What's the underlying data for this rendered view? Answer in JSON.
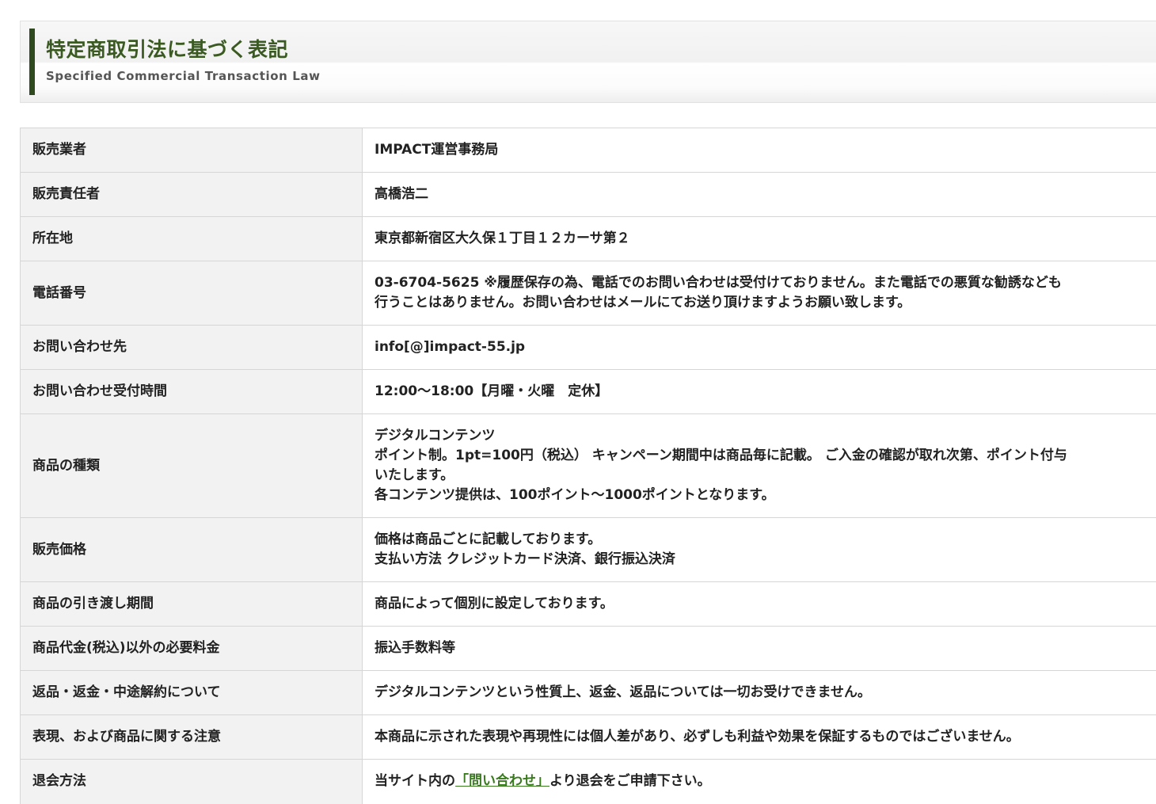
{
  "header": {
    "title": "特定商取引法に基づく表記",
    "subtitle": "Specified Commercial Transaction Law"
  },
  "rows": [
    {
      "label": "販売業者",
      "value": [
        "IMPACT運営事務局"
      ]
    },
    {
      "label": "販売責任者",
      "value": [
        "高橋浩二"
      ]
    },
    {
      "label": "所在地",
      "value": [
        "東京都新宿区大久保１丁目１２カーサ第２"
      ]
    },
    {
      "label": "電話番号",
      "value": [
        "03-6704-5625 ※履歴保存の為、電話でのお問い合わせは受付けておりません。また電話での悪質な勧誘なども",
        "行うことはありません。お問い合わせはメールにてお送り頂けますようお願い致します。"
      ]
    },
    {
      "label": "お問い合わせ先",
      "value": [
        "info[@]impact-55.jp"
      ]
    },
    {
      "label": "お問い合わせ受付時間",
      "value": [
        "12:00～18:00【月曜・火曜　定休】"
      ]
    },
    {
      "label": "商品の種類",
      "value": [
        "デジタルコンテンツ",
        "ポイント制。1pt=100円（税込） キャンペーン期間中は商品毎に記載。 ご入金の確認が取れ次第、ポイント付与",
        "いたします。",
        "各コンテンツ提供は、100ポイント～1000ポイントとなります。"
      ]
    },
    {
      "label": "販売価格",
      "value": [
        "価格は商品ごとに記載しております。",
        "支払い方法 クレジットカード決済、銀行振込決済"
      ]
    },
    {
      "label": "商品の引き渡し期間",
      "value": [
        "商品によって個別に設定しております。"
      ]
    },
    {
      "label": "商品代金(税込)以外の必要料金",
      "value": [
        "振込手数料等"
      ]
    },
    {
      "label": "返品・返金・中途解約について",
      "value": [
        "デジタルコンテンツという性質上、返金、返品については一切お受けできません。"
      ]
    },
    {
      "label": "表現、および商品に関する注意",
      "value": [
        "本商品に示された表現や再現性には個人差があり、必ずしも利益や効果を保証するものではございません。"
      ]
    },
    {
      "label": "退会方法",
      "value_prefix": "当サイト内の",
      "link_text": "「問い合わせ」",
      "value_suffix": "より退会をご申請下さい。"
    }
  ],
  "colors": {
    "accent_bar": "#2f4a1e",
    "title_text": "#3a5a21",
    "link": "#3a7a1e",
    "label_bg": "#f2f2f2",
    "border": "#d6d6d6"
  }
}
